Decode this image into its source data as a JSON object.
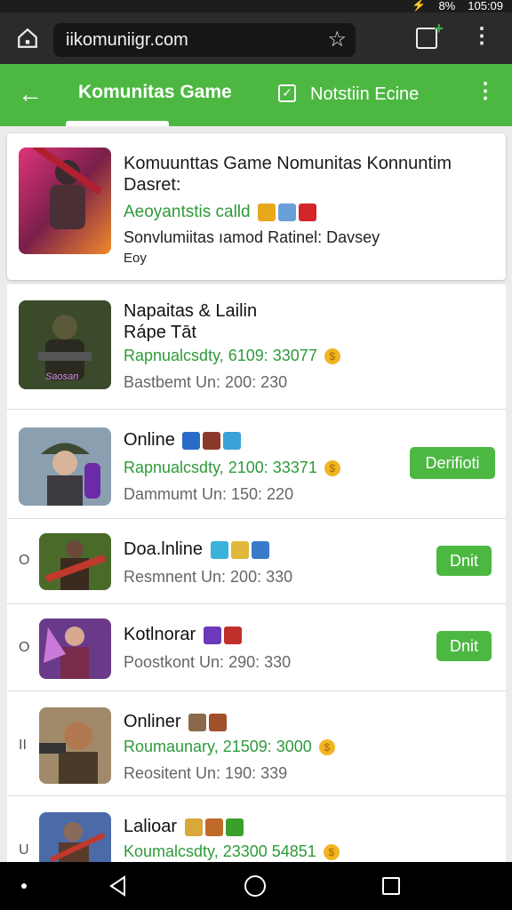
{
  "status": {
    "battery": "8%",
    "time": "105:09"
  },
  "browser": {
    "url": "iikomuniigr.com",
    "bookmark_icon": "star-icon",
    "menu_icon": "more-vertical-icon"
  },
  "app_bar": {
    "back_icon": "arrow-left-icon",
    "tab_active": "Komunitas Game",
    "tab_second": "Notstiin Ecine",
    "tab_second_icon": "check-square-icon",
    "menu_icon": "more-vertical-icon",
    "colors": {
      "primary": "#4cb842",
      "text_green": "#2e9a3a"
    }
  },
  "featured": {
    "title": "Komuunttas Game Nomunitas Konnuntim Dasret:",
    "green_line": "Aeoyantstis calld",
    "line": "Sonvlumiitas ıamod Ratinel: Davsey",
    "small": "Eoy"
  },
  "list": [
    {
      "lead": "",
      "name": "Napaitas & Lailin\nRápe Tāt",
      "stat": "Rapnualcsdty, 6109: 33077",
      "sub": "Bastbemt Un: 200: 230",
      "button": "",
      "thumb_label": "Saosan"
    },
    {
      "lead": "",
      "name": "Online",
      "stat": "Rapnualcsdty, 2100: 33371",
      "sub": "Dammumt Un: 150: 220",
      "button": "Derifioti",
      "thumb_label": ""
    },
    {
      "lead": "O",
      "name": "Doa.lnline",
      "stat": "",
      "sub": "Resmnent Un: 200: 330",
      "button": "Dnit",
      "thumb_label": ""
    },
    {
      "lead": "O",
      "name": "Kotlnorar",
      "stat": "",
      "sub": "Poostkont Un: 290: 330",
      "button": "Dnit",
      "thumb_label": ""
    },
    {
      "lead": "II",
      "name": "Onliner",
      "stat": "Roumaunary, 21509: 3000",
      "sub": "Reositent Un: 190: 339",
      "button": "",
      "thumb_label": ""
    },
    {
      "lead": "U",
      "name": "Lalioar",
      "stat": "Koumalcsdty, 23300 54851",
      "sub": "",
      "button": "",
      "thumb_label": ""
    }
  ]
}
